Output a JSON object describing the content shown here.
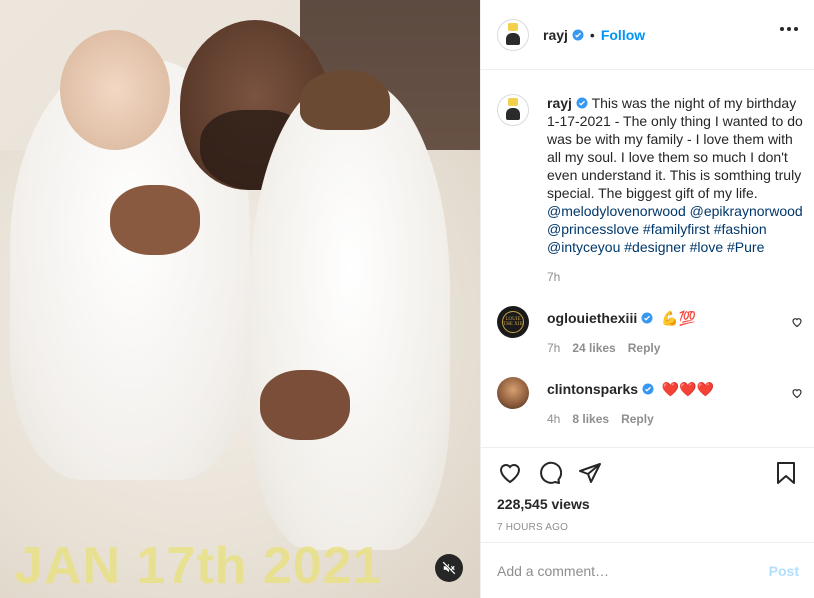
{
  "media": {
    "overlay_text": "JAN 17th 2021",
    "mute_icon": "speaker-muted-icon"
  },
  "header": {
    "username": "rayj",
    "separator": "•",
    "follow_label": "Follow",
    "more_icon": "more-options-icon"
  },
  "caption": {
    "username": "rayj",
    "text": "This was the night of my birthday 1-17-2021 - The only thing I wanted to do was be with my family - I love them with all my soul. I love them so much I don't even understand it. This is somthing truly special. The biggest gift of my life.",
    "tags": [
      "@melodylovenorwood",
      "@epikraynorwood",
      "@princesslove",
      "#familyfirst",
      "#fashion",
      "@intyceyou",
      "#designer",
      "#love",
      "#Pure"
    ],
    "time": "7h"
  },
  "comments": [
    {
      "username": "oglouiethexiii",
      "text": "💪💯",
      "time": "7h",
      "likes": "24 likes",
      "reply": "Reply",
      "avatar_text": "LOUIE THE XIII"
    },
    {
      "username": "clintonsparks",
      "text": "❤️❤️❤️",
      "time": "4h",
      "likes": "8 likes",
      "reply": "Reply"
    }
  ],
  "actions": {
    "icons": [
      "heart-icon",
      "comment-icon",
      "share-icon",
      "bookmark-icon"
    ],
    "views": "228,545 views",
    "time_ago": "7 HOURS AGO"
  },
  "add_comment": {
    "placeholder": "Add a comment…",
    "post_label": "Post"
  },
  "colors": {
    "accent": "#0095f6",
    "link": "#00376b",
    "verified": "#3897f0",
    "muted": "#8e8e8e",
    "overlay_text": "#e9e18a"
  }
}
